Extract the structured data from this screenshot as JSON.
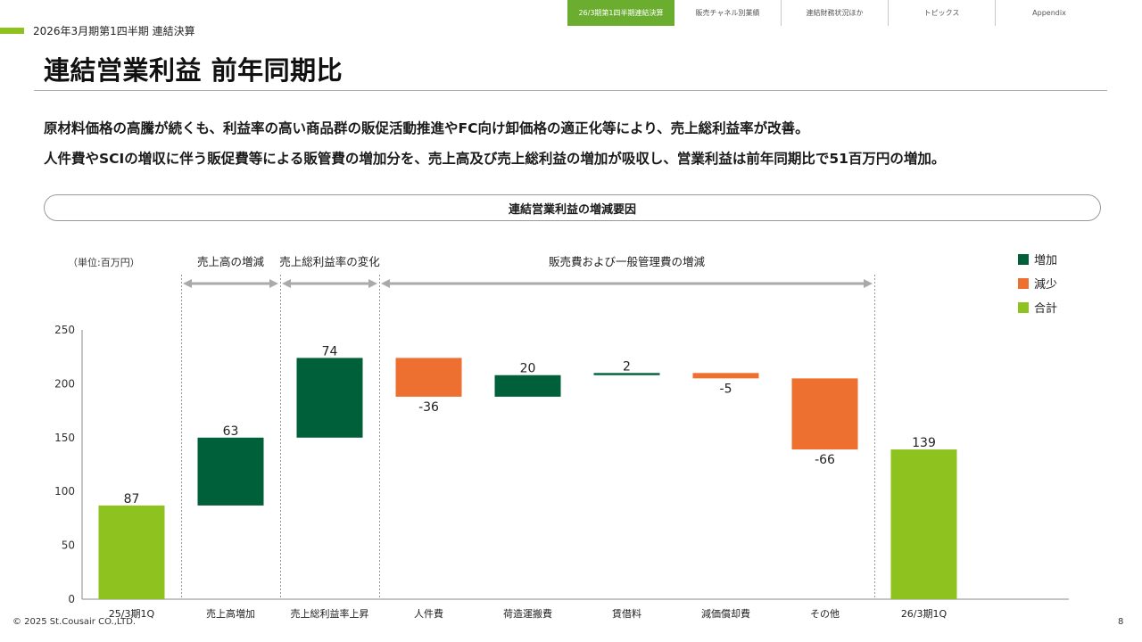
{
  "nav": {
    "tabs": [
      {
        "label": "26/3期第1四半期連結決算",
        "active": true
      },
      {
        "label": "販売チャネル別業績",
        "active": false
      },
      {
        "label": "連結財務状況ほか",
        "active": false
      },
      {
        "label": "トピックス",
        "active": false
      },
      {
        "label": "Appendix",
        "active": false
      }
    ]
  },
  "header": {
    "section_label": "2026年3月期第1四半期 連結決算",
    "title": "連結営業利益 前年同期比"
  },
  "summary": {
    "line1": "原材料価格の高騰が続くも、利益率の高い商品群の販促活動推進やFC向け卸価格の適正化等により、売上総利益率が改善。",
    "line2": "人件費やSCIの増収に伴う販促費等による販管費の増加分を、売上高及び売上総利益の増加が吸収し、営業利益は前年同期比で51百万円の増加。"
  },
  "chart_box_title": "連結営業利益の増減要因",
  "chart_data": {
    "type": "bar",
    "subtype": "waterfall",
    "unit_label": "（単位:百万円）",
    "ylim": [
      0,
      250
    ],
    "yticks": [
      0,
      50,
      100,
      150,
      200,
      250
    ],
    "grid": false,
    "legend_position": "top-right",
    "legend": [
      {
        "key": "increase",
        "label": "増加",
        "color": "#00603a"
      },
      {
        "key": "decrease",
        "label": "減少",
        "color": "#ed7030"
      },
      {
        "key": "total",
        "label": "合計",
        "color": "#8dc21f"
      }
    ],
    "groups": [
      {
        "label": "売上高の増減",
        "start": 1,
        "end": 1
      },
      {
        "label": "売上総利益率の変化",
        "start": 2,
        "end": 2
      },
      {
        "label": "販売費および一般管理費の増減",
        "start": 3,
        "end": 7
      }
    ],
    "bars": [
      {
        "category": "25/3期1Q",
        "label": "87",
        "type": "total",
        "value": 87
      },
      {
        "category": "売上高増加",
        "label": "63",
        "type": "increase",
        "base": 87,
        "value": 63
      },
      {
        "category": "売上総利益率上昇",
        "label": "74",
        "type": "increase",
        "base": 150,
        "value": 74
      },
      {
        "category": "人件費",
        "label": "-36",
        "type": "decrease",
        "base": 224,
        "value": -36
      },
      {
        "category": "荷造運搬費",
        "label": "20",
        "type": "increase",
        "base": 188,
        "value": 20
      },
      {
        "category": "賃借料",
        "label": "2",
        "type": "increase",
        "base": 208,
        "value": 2
      },
      {
        "category": "減価償却費",
        "label": "-5",
        "type": "decrease",
        "base": 210,
        "value": -5
      },
      {
        "category": "その他",
        "label": "-66",
        "type": "decrease",
        "base": 205,
        "value": -66
      },
      {
        "category": "26/3期1Q",
        "label": "139",
        "type": "total",
        "value": 139
      }
    ]
  },
  "footer": {
    "copyright": "© 2025 St.Cousair CO.,LTD.",
    "page": "8"
  }
}
